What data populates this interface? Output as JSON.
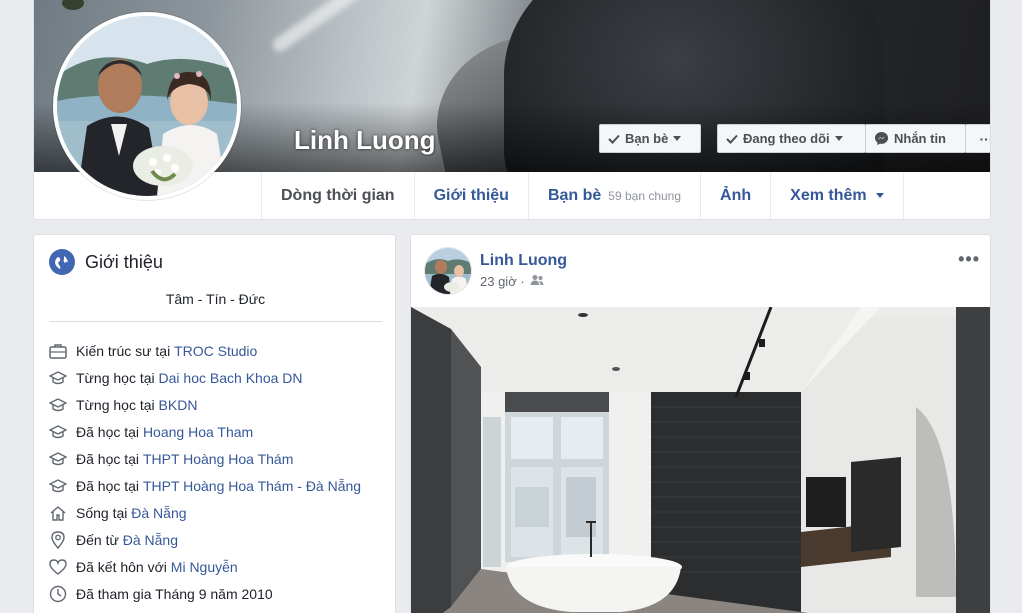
{
  "profile": {
    "name": "Linh Luong",
    "buttons": {
      "friends": "Bạn bè",
      "following": "Đang theo dõi",
      "message": "Nhắn tin",
      "more": "···"
    },
    "tabs": [
      {
        "label": "Dòng thời gian"
      },
      {
        "label": "Giới thiệu"
      },
      {
        "label": "Bạn bè",
        "sub": "59 bạn chung"
      },
      {
        "label": "Ảnh"
      },
      {
        "label": "Xem thêm"
      }
    ]
  },
  "intro": {
    "title": "Giới thiệu",
    "motto": "Tâm - Tín - Đức",
    "items": [
      {
        "icon": "briefcase-icon",
        "text": "Kiến trúc sư tại ",
        "link": "TROC Studio"
      },
      {
        "icon": "graduation-cap-icon",
        "text": "Từng học tại ",
        "link": "Dai hoc Bach Khoa DN"
      },
      {
        "icon": "graduation-cap-icon",
        "text": "Từng học tại ",
        "link": "BKDN"
      },
      {
        "icon": "graduation-cap-icon",
        "text": "Đã học tại ",
        "link": "Hoang Hoa Tham"
      },
      {
        "icon": "graduation-cap-icon",
        "text": "Đã học tại ",
        "link": "THPT Hoàng Hoa Thám"
      },
      {
        "icon": "graduation-cap-icon",
        "text": "Đã học tại ",
        "link": "THPT Hoàng Hoa Thám - Đà Nẵng"
      },
      {
        "icon": "home-icon",
        "text": "Sống tại ",
        "link": "Đà Nẵng"
      },
      {
        "icon": "location-pin-icon",
        "text": "Đến từ ",
        "link": "Đà Nẵng"
      },
      {
        "icon": "heart-icon",
        "text": "Đã kết hôn với ",
        "link": "Mi Nguyễn"
      },
      {
        "icon": "clock-icon",
        "text": "Đã tham gia Tháng 9 năm 2010",
        "link": ""
      }
    ]
  },
  "post": {
    "author": "Linh Luong",
    "time": "23 giờ ·",
    "audience_icon": "friends-audience-icon",
    "menu": "•••"
  },
  "colors": {
    "brand_blue": "#4267b2",
    "link_blue": "#365899",
    "page_bg": "#e9ebee"
  }
}
